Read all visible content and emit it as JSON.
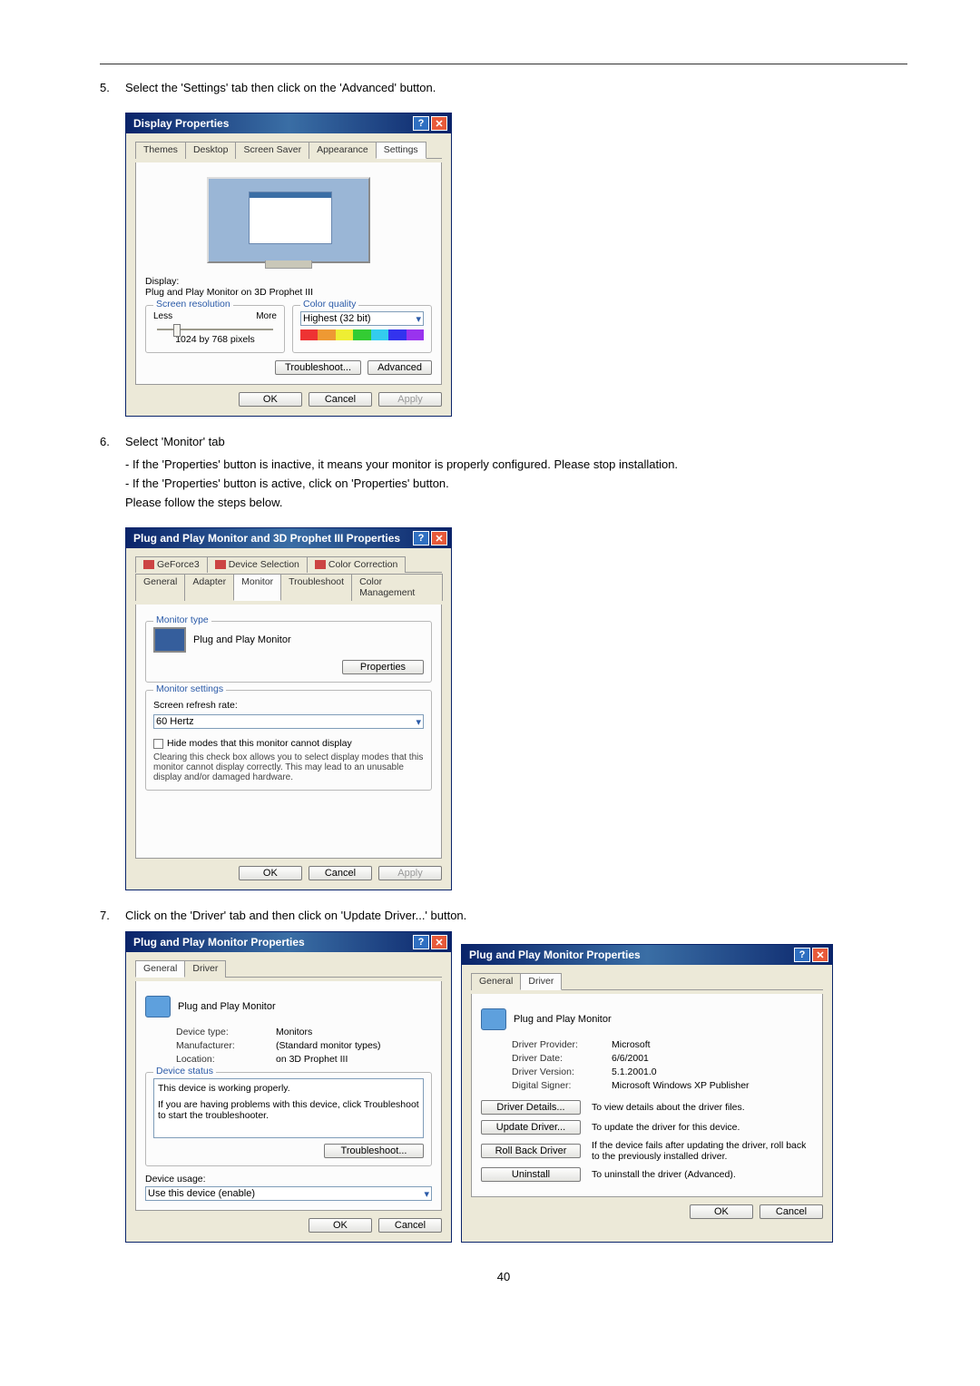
{
  "page_number": "40",
  "step5": {
    "num": "5.",
    "text": "Select the 'Settings' tab then click on the 'Advanced' button."
  },
  "step6": {
    "num": "6.",
    "text": "Select 'Monitor' tab",
    "bullet1": "- If the 'Properties' button is inactive, it means your monitor is properly configured. Please stop installation.",
    "bullet2": "- If the 'Properties' button is active, click on 'Properties' button.",
    "follow": "Please follow the steps below."
  },
  "step7": {
    "num": "7.",
    "text": "Click on the 'Driver' tab and then click on 'Update Driver...' button."
  },
  "dlg1": {
    "title": "Display Properties",
    "tabs": {
      "themes": "Themes",
      "desktop": "Desktop",
      "ss": "Screen Saver",
      "appearance": "Appearance",
      "settings": "Settings"
    },
    "display_lbl": "Display:",
    "display_val": "Plug and Play Monitor on 3D Prophet III",
    "sr_legend": "Screen resolution",
    "less": "Less",
    "more": "More",
    "res": "1024 by 768 pixels",
    "cq_legend": "Color quality",
    "cq_val": "Highest (32 bit)",
    "troubleshoot": "Troubleshoot...",
    "advanced": "Advanced",
    "ok": "OK",
    "cancel": "Cancel",
    "apply": "Apply"
  },
  "dlg2": {
    "title": "Plug and Play Monitor and 3D Prophet III Properties",
    "tabs_top": {
      "geforce": "GeForce3",
      "devsel": "Device Selection",
      "cc": "Color Correction"
    },
    "tabs_bot": {
      "general": "General",
      "adapter": "Adapter",
      "monitor": "Monitor",
      "ts": "Troubleshoot",
      "cm": "Color Management"
    },
    "mt_legend": "Monitor type",
    "mt_val": "Plug and Play Monitor",
    "properties": "Properties",
    "ms_legend": "Monitor settings",
    "srr_lbl": "Screen refresh rate:",
    "srr_val": "60 Hertz",
    "hide_lbl": "Hide modes that this monitor cannot display",
    "hide_desc": "Clearing this check box allows you to select display modes that this monitor cannot display correctly. This may lead to an unusable display and/or damaged hardware.",
    "ok": "OK",
    "cancel": "Cancel",
    "apply": "Apply"
  },
  "dlg3": {
    "title": "Plug and Play Monitor Properties",
    "tabs": {
      "general": "General",
      "driver": "Driver"
    },
    "name": "Plug and Play Monitor",
    "devtype_lbl": "Device type:",
    "devtype": "Monitors",
    "manu_lbl": "Manufacturer:",
    "manu": "(Standard monitor types)",
    "loc_lbl": "Location:",
    "loc": "on 3D Prophet III",
    "ds_legend": "Device status",
    "ds_line1": "This device is working properly.",
    "ds_line2": "If you are having problems with this device, click Troubleshoot to start the troubleshooter.",
    "ts_btn": "Troubleshoot...",
    "du_lbl": "Device usage:",
    "du_val": "Use this device (enable)",
    "ok": "OK",
    "cancel": "Cancel"
  },
  "dlg4": {
    "title": "Plug and Play Monitor Properties",
    "tabs": {
      "general": "General",
      "driver": "Driver"
    },
    "name": "Plug and Play Monitor",
    "dp_lbl": "Driver Provider:",
    "dp": "Microsoft",
    "dd_lbl": "Driver Date:",
    "dd": "6/6/2001",
    "dv_lbl": "Driver Version:",
    "dv": "5.1.2001.0",
    "ds_lbl": "Digital Signer:",
    "ds": "Microsoft Windows XP Publisher",
    "btn_det": "Driver Details...",
    "desc_det": "To view details about the driver files.",
    "btn_upd": "Update Driver...",
    "desc_upd": "To update the driver for this device.",
    "btn_roll": "Roll Back Driver",
    "desc_roll": "If the device fails after updating the driver, roll back to the previously installed driver.",
    "btn_un": "Uninstall",
    "desc_un": "To uninstall the driver (Advanced).",
    "ok": "OK",
    "cancel": "Cancel"
  }
}
